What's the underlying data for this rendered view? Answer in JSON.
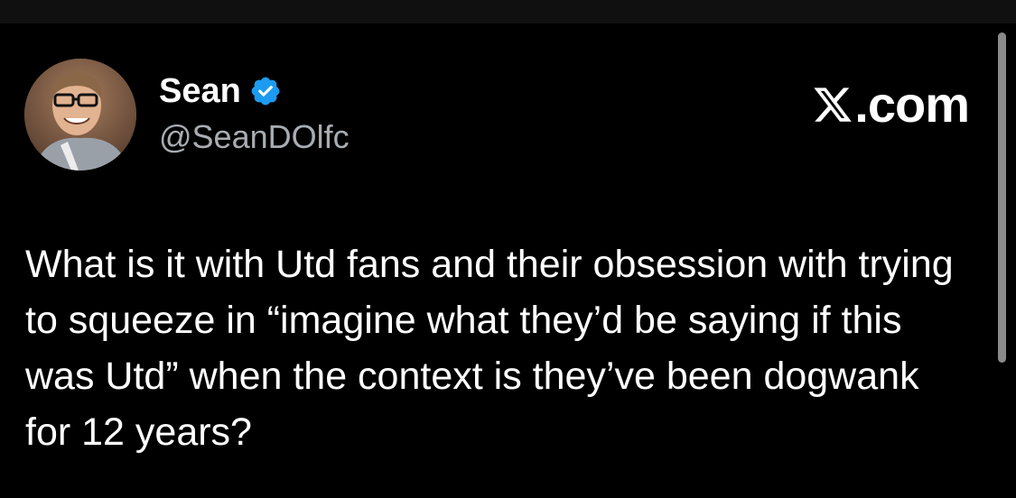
{
  "tweet": {
    "author": {
      "display_name": "Sean",
      "handle": "@SeanDOlfc",
      "verified": true,
      "verified_icon": "verified-badge-icon"
    },
    "brand": {
      "icon": "x-logo-icon",
      "text": ".com"
    },
    "text": "What is it with Utd fans and their obsession with trying to squeeze in “imagine what they’d be saying if this was Utd” when the context is they’ve been dogwank for 12 years?"
  },
  "colors": {
    "background": "#000000",
    "text": "#ffffff",
    "handle": "#a8adb2",
    "verified": "#1d9bf0"
  }
}
